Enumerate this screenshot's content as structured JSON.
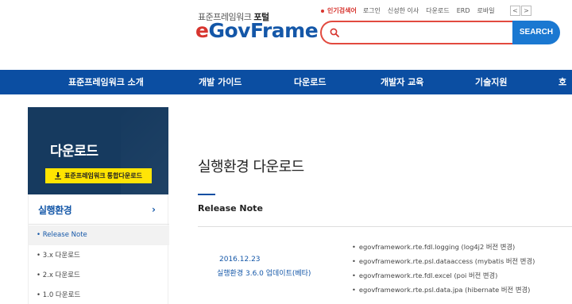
{
  "header": {
    "logo_sub_prefix": "표준프레임워크",
    "logo_sub_bold": "포털",
    "logo_e": "e",
    "logo_rest": "GovFrame",
    "popular_label": "인기검색어",
    "keywords": [
      "로그인",
      "신성한 이사",
      "다운로드",
      "ERD",
      "로바일"
    ],
    "arrow_left": "<",
    "arrow_right": ">",
    "search_placeholder": "",
    "search_button": "SEARCH"
  },
  "gnb": {
    "items": [
      "표준프레임워크 소개",
      "개발 가이드",
      "다운로드",
      "개발자 교육",
      "기술지원",
      "호"
    ]
  },
  "sidebar": {
    "title": "다운로드",
    "download_button": "표준프레임워크 통합다운로드",
    "current": "실행환경",
    "chevron": "›",
    "items": [
      "• Release Note",
      "• 3.x 다운로드",
      "• 2.x 다운로드",
      "• 1.0 다운로드"
    ]
  },
  "content": {
    "page_title": "실행환경 다운로드",
    "section_title": "Release Note",
    "release": {
      "date": "2016.12.23",
      "version": "실행환경 3.6.0 업데이트(베타)",
      "notes": [
        "egovframework.rte.fdl.logging (log4j2 버전 변경)",
        "egovframework.rte.psl.dataaccess (mybatis 버전 변경)",
        "egovframework.rte.fdl.excel (poi 버전 변경)",
        "egovframework.rte.psl.data.jpa (hibernate 버전 변경)"
      ]
    }
  },
  "colors": {
    "brand_blue": "#0b4ea2",
    "brand_red": "#d7352f",
    "search_blue": "#1a78d1",
    "sidebar_dark": "#163a5f",
    "highlight_yellow": "#ffe400"
  }
}
